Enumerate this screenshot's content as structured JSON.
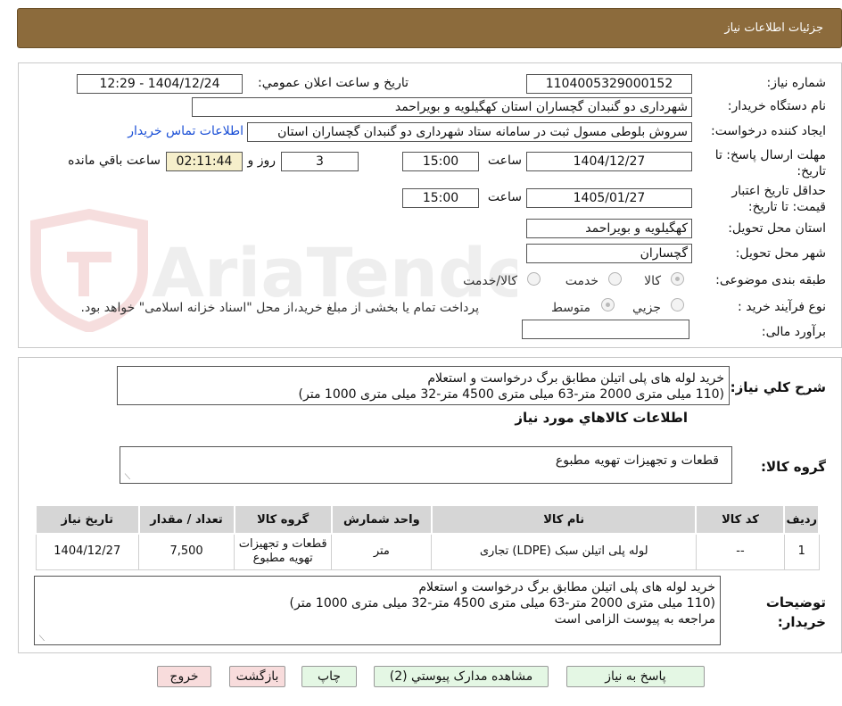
{
  "header": {
    "title": "جزئیات اطلاعات نیاز"
  },
  "form": {
    "need_number": {
      "label": "شماره نیاز:",
      "value": "1104005329000152"
    },
    "announce_datetime": {
      "label": "تاریخ و ساعت اعلان عمومي:",
      "value": "1404/12/24 - 12:29"
    },
    "buyer_org": {
      "label": "نام دستگاه خریدار:",
      "value": "شهرداری دو گنبدان گچساران استان کهگیلویه و بویراحمد"
    },
    "requester": {
      "label": "ایجاد کننده درخواست:",
      "value": "سروش بلوطی مسول ثبت در سامانه ستاد شهرداری دو گنبدان گچساران استان",
      "link": "اطلاعات تماس خریدار"
    },
    "deadline": {
      "label": "مهلت ارسال پاسخ: تا تاریخ:",
      "date": "1404/12/27",
      "time_label": "ساعت",
      "time": "15:00",
      "days": "3",
      "days_label": "روز و",
      "remaining": "02:11:44",
      "remaining_label": "ساعت باقي مانده"
    },
    "validity": {
      "label": "حداقل تاریخ اعتبار قیمت: تا تاریخ:",
      "date": "1405/01/27",
      "time_label": "ساعت",
      "time": "15:00"
    },
    "province": {
      "label": "استان محل تحویل:",
      "value": "کهگیلویه و بویراحمد"
    },
    "city": {
      "label": "شهر محل تحویل:",
      "value": "گچساران"
    },
    "category": {
      "label": "طبقه بندی موضوعی:",
      "options": [
        "کالا",
        "خدمت",
        "کالا/خدمت"
      ]
    },
    "process": {
      "label": "نوع فرآیند خرید :",
      "options": [
        "جزیي",
        "متوسط"
      ],
      "note": "پرداخت تمام یا بخشی از مبلغ خرید،از محل \"اسناد خزانه اسلامی\" خواهد بود."
    },
    "estimate": {
      "label": "برآورد مالی:",
      "value": ""
    }
  },
  "summary": {
    "label": "شرح کلي نیاز:",
    "lines": [
      "خرید لوله های پلی اتیلن مطابق برگ درخواست و استعلام",
      "(110 میلی متری 2000 متر-63 میلی متری 4500 متر-32 میلی متری 1000 متر)"
    ]
  },
  "goods_info_title": "اطلاعات کالاهاي مورد نیاز",
  "goods_group": {
    "label": "گروه کالا:",
    "value": "قطعات و تجهیزات تهویه مطبوع"
  },
  "table": {
    "headers": [
      "ردیف",
      "کد کالا",
      "نام کالا",
      "واحد شمارش",
      "گروه کالا",
      "تعداد / مقدار",
      "تاریخ نیاز"
    ],
    "rows": [
      [
        "1",
        "--",
        "لوله پلی اتیلن سبک (LDPE) تجاری",
        "متر",
        "قطعات و تجهیزات تهویه مطبوع",
        "7,500",
        "1404/12/27"
      ]
    ]
  },
  "buyer_notes": {
    "label": "توضیحات خریدار:",
    "lines": [
      "خرید لوله های پلی اتیلن مطابق برگ درخواست و استعلام",
      "(110 میلی متری 2000 متر-63 میلی متری 4500 متر-32 میلی متری 1000 متر)",
      "مراجعه به پیوست الزامی است"
    ]
  },
  "buttons": {
    "reply": "پاسخ به نیاز",
    "attachments": "مشاهده مدارک پیوستي (2)",
    "print": "چاپ",
    "back": "بازگشت",
    "exit": "خروج"
  },
  "watermark": "AriaTender.neT",
  "colors": {
    "header": "#8c6b3c",
    "link": "#1a4fd6",
    "green_button": "#e4f7e4",
    "pink_button": "#f8dcdc",
    "remaining_bg": "#f6efcb"
  }
}
